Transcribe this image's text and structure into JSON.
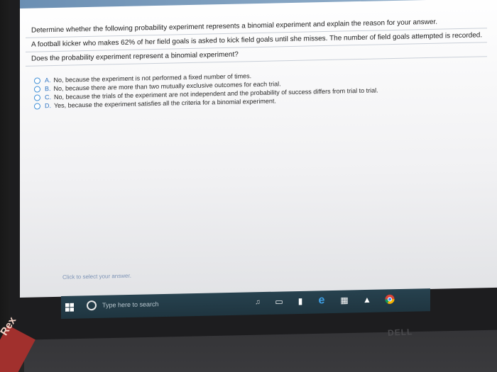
{
  "question": {
    "title": "Determine whether the following probability experiment represents a binomial experiment and explain the reason for your answer.",
    "scenario": "A football kicker who makes 62% of her field goals is asked to kick field goals until she misses. The number of field goals attempted is recorded.",
    "prompt": "Does the probability experiment represent a binomial experiment?"
  },
  "options": [
    {
      "letter": "A.",
      "text": "No, because the experiment is not performed a fixed number of times."
    },
    {
      "letter": "B.",
      "text": "No, because there are more than two mutually exclusive outcomes for each trial."
    },
    {
      "letter": "C.",
      "text": "No, because the trials of the experiment are not independent and the probability of success differs from trial to trial."
    },
    {
      "letter": "D.",
      "text": "Yes, because the experiment satisfies all the criteria for a binomial experiment."
    }
  ],
  "answer_hint": "Click to select your answer.",
  "taskbar": {
    "search_placeholder": "Type here to search",
    "icons": [
      "windows-start-icon",
      "cortana-icon",
      "microphone-icon",
      "task-view-icon",
      "file-explorer-icon",
      "edge-icon",
      "store-icon",
      "app-icon",
      "chrome-icon"
    ]
  },
  "monitor_brand": "DELL",
  "book_text": "Rex",
  "colors": {
    "accent": "#3f8fd6",
    "taskbar": "#27424f",
    "hint": "#7c93b5"
  }
}
